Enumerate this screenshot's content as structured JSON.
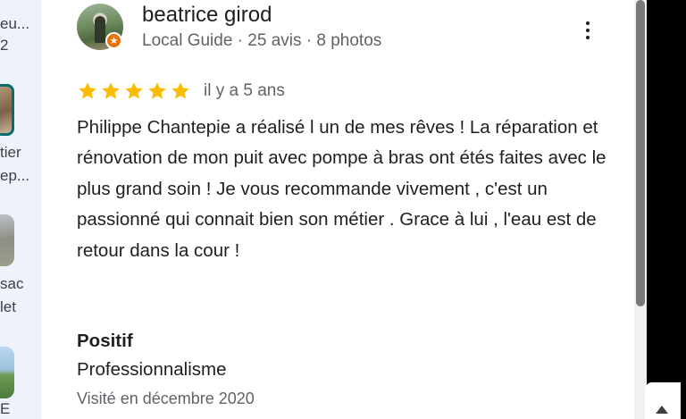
{
  "sidebar": {
    "fragments": [
      "eu...",
      "2",
      "tier",
      "ep...",
      "sac",
      "let",
      "E"
    ]
  },
  "review": {
    "reviewer": {
      "name": "beatrice girod",
      "meta": "Local Guide · 25 avis · 8 photos",
      "badge_icon": "local-guide-star-icon"
    },
    "rating": {
      "stars": 5,
      "max": 5,
      "color": "#fbbc04"
    },
    "time": "il y a 5 ans",
    "text": "Philippe Chantepie a réalisé l un de mes rêves ! La réparation et rénovation de mon puit avec pompe à bras ont étés faites avec le plus grand soin ! Je vous recommande vivement , c'est un passionné qui connait bien son métier . Grace à lui , l'eau est de retour dans la cour !",
    "attribute": {
      "heading": "Positif",
      "value": "Professionnalisme"
    },
    "visited": "Visité en décembre 2020",
    "more_icon": "more-vert-icon"
  },
  "colors": {
    "accent_star": "#fbbc04",
    "guide_badge": "#e8710a",
    "text_primary": "#1f1f1f",
    "text_secondary": "#5f6368"
  }
}
